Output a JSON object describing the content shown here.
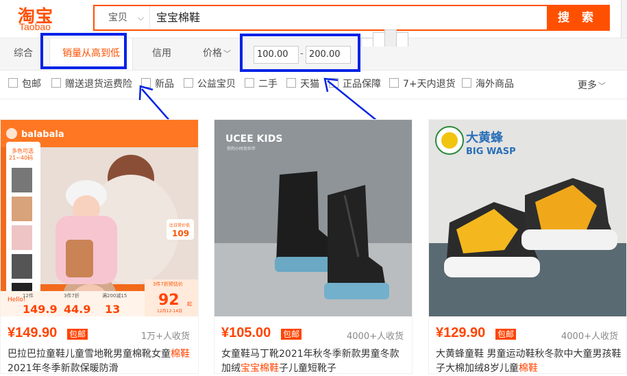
{
  "header": {
    "logo_zh": "淘宝",
    "logo_en": "Taobao",
    "search_category": "宝贝",
    "search_query": "宝宝棉鞋",
    "search_button": "搜 索"
  },
  "sortbar": {
    "sorts": [
      "综合",
      "销量从高到低",
      "信用",
      "价格"
    ],
    "price_min": "100.00",
    "price_dash": "-",
    "price_max": "200.00"
  },
  "filters": {
    "items": [
      "包邮",
      "赠送退货运费险",
      "新品",
      "公益宝贝",
      "二手",
      "天猫",
      "正品保障",
      "7+天内退货",
      "海外商品"
    ],
    "more": "更多"
  },
  "products": [
    {
      "price": "¥149.90",
      "badge": "包邮",
      "sales": "1万+人收货",
      "title_pre": "巴拉巴拉童鞋儿童雪地靴男童棉靴女童",
      "title_hl": "棉鞋",
      "title_post": "2021年冬季新款保暖防滑",
      "img": {
        "brand": "balabala",
        "promo_top": "多色可选",
        "promo_size": "21~40码",
        "tag_small": "比日常价低",
        "tag_num": "109",
        "tag_pre": "3件7折预估价",
        "big_price": "92",
        "big_unit": "起",
        "date": "12月12-14日",
        "p1_lbl": "12件",
        "p1": "149.9",
        "p2_lbl": "3件7折",
        "p2": "44.9",
        "p3_lbl": "满200减15",
        "p3": "13",
        "happy": "Hello!"
      }
    },
    {
      "price": "¥105.00",
      "badge": "包邮",
      "sales": "4000+人收货",
      "title_pre": "女童鞋马丁靴2021年秋冬季新款男童冬款加绒",
      "title_hl": "宝宝棉鞋",
      "title_post": "子儿童短靴子",
      "img": {
        "brand": "UCEE KIDS",
        "sub": "你的小时尚伙伴"
      }
    },
    {
      "price": "¥129.90",
      "badge": "包邮",
      "sales": "4000+人收货",
      "title_pre": "大黄蜂童鞋 男童运动鞋秋冬款中大童男孩鞋子大棉加绒8岁儿童",
      "title_hl": "棉鞋",
      "title_post": "",
      "img": {
        "brand_zh": "大黄蜂",
        "brand_en": "BIG WASP"
      }
    }
  ],
  "colors": {
    "accent": "#ff5000",
    "price": "#ff4400",
    "annotation": "#0022e6"
  }
}
